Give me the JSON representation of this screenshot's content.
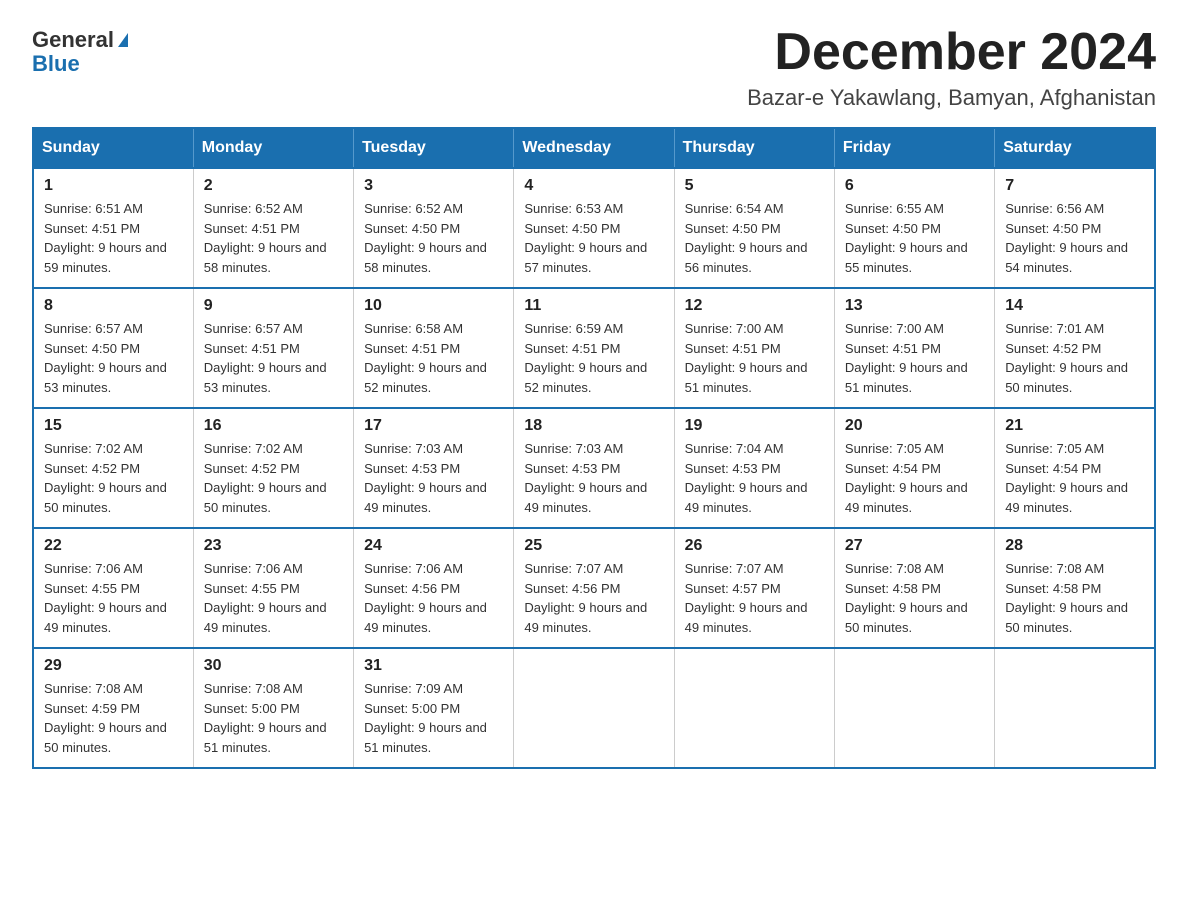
{
  "header": {
    "logo_general": "General",
    "logo_blue": "Blue",
    "month_title": "December 2024",
    "location": "Bazar-e Yakawlang, Bamyan, Afghanistan"
  },
  "days_of_week": [
    "Sunday",
    "Monday",
    "Tuesday",
    "Wednesday",
    "Thursday",
    "Friday",
    "Saturday"
  ],
  "weeks": [
    [
      {
        "day": "1",
        "sunrise": "6:51 AM",
        "sunset": "4:51 PM",
        "daylight": "9 hours and 59 minutes."
      },
      {
        "day": "2",
        "sunrise": "6:52 AM",
        "sunset": "4:51 PM",
        "daylight": "9 hours and 58 minutes."
      },
      {
        "day": "3",
        "sunrise": "6:52 AM",
        "sunset": "4:50 PM",
        "daylight": "9 hours and 58 minutes."
      },
      {
        "day": "4",
        "sunrise": "6:53 AM",
        "sunset": "4:50 PM",
        "daylight": "9 hours and 57 minutes."
      },
      {
        "day": "5",
        "sunrise": "6:54 AM",
        "sunset": "4:50 PM",
        "daylight": "9 hours and 56 minutes."
      },
      {
        "day": "6",
        "sunrise": "6:55 AM",
        "sunset": "4:50 PM",
        "daylight": "9 hours and 55 minutes."
      },
      {
        "day": "7",
        "sunrise": "6:56 AM",
        "sunset": "4:50 PM",
        "daylight": "9 hours and 54 minutes."
      }
    ],
    [
      {
        "day": "8",
        "sunrise": "6:57 AM",
        "sunset": "4:50 PM",
        "daylight": "9 hours and 53 minutes."
      },
      {
        "day": "9",
        "sunrise": "6:57 AM",
        "sunset": "4:51 PM",
        "daylight": "9 hours and 53 minutes."
      },
      {
        "day": "10",
        "sunrise": "6:58 AM",
        "sunset": "4:51 PM",
        "daylight": "9 hours and 52 minutes."
      },
      {
        "day": "11",
        "sunrise": "6:59 AM",
        "sunset": "4:51 PM",
        "daylight": "9 hours and 52 minutes."
      },
      {
        "day": "12",
        "sunrise": "7:00 AM",
        "sunset": "4:51 PM",
        "daylight": "9 hours and 51 minutes."
      },
      {
        "day": "13",
        "sunrise": "7:00 AM",
        "sunset": "4:51 PM",
        "daylight": "9 hours and 51 minutes."
      },
      {
        "day": "14",
        "sunrise": "7:01 AM",
        "sunset": "4:52 PM",
        "daylight": "9 hours and 50 minutes."
      }
    ],
    [
      {
        "day": "15",
        "sunrise": "7:02 AM",
        "sunset": "4:52 PM",
        "daylight": "9 hours and 50 minutes."
      },
      {
        "day": "16",
        "sunrise": "7:02 AM",
        "sunset": "4:52 PM",
        "daylight": "9 hours and 50 minutes."
      },
      {
        "day": "17",
        "sunrise": "7:03 AM",
        "sunset": "4:53 PM",
        "daylight": "9 hours and 49 minutes."
      },
      {
        "day": "18",
        "sunrise": "7:03 AM",
        "sunset": "4:53 PM",
        "daylight": "9 hours and 49 minutes."
      },
      {
        "day": "19",
        "sunrise": "7:04 AM",
        "sunset": "4:53 PM",
        "daylight": "9 hours and 49 minutes."
      },
      {
        "day": "20",
        "sunrise": "7:05 AM",
        "sunset": "4:54 PM",
        "daylight": "9 hours and 49 minutes."
      },
      {
        "day": "21",
        "sunrise": "7:05 AM",
        "sunset": "4:54 PM",
        "daylight": "9 hours and 49 minutes."
      }
    ],
    [
      {
        "day": "22",
        "sunrise": "7:06 AM",
        "sunset": "4:55 PM",
        "daylight": "9 hours and 49 minutes."
      },
      {
        "day": "23",
        "sunrise": "7:06 AM",
        "sunset": "4:55 PM",
        "daylight": "9 hours and 49 minutes."
      },
      {
        "day": "24",
        "sunrise": "7:06 AM",
        "sunset": "4:56 PM",
        "daylight": "9 hours and 49 minutes."
      },
      {
        "day": "25",
        "sunrise": "7:07 AM",
        "sunset": "4:56 PM",
        "daylight": "9 hours and 49 minutes."
      },
      {
        "day": "26",
        "sunrise": "7:07 AM",
        "sunset": "4:57 PM",
        "daylight": "9 hours and 49 minutes."
      },
      {
        "day": "27",
        "sunrise": "7:08 AM",
        "sunset": "4:58 PM",
        "daylight": "9 hours and 50 minutes."
      },
      {
        "day": "28",
        "sunrise": "7:08 AM",
        "sunset": "4:58 PM",
        "daylight": "9 hours and 50 minutes."
      }
    ],
    [
      {
        "day": "29",
        "sunrise": "7:08 AM",
        "sunset": "4:59 PM",
        "daylight": "9 hours and 50 minutes."
      },
      {
        "day": "30",
        "sunrise": "7:08 AM",
        "sunset": "5:00 PM",
        "daylight": "9 hours and 51 minutes."
      },
      {
        "day": "31",
        "sunrise": "7:09 AM",
        "sunset": "5:00 PM",
        "daylight": "9 hours and 51 minutes."
      },
      null,
      null,
      null,
      null
    ]
  ]
}
